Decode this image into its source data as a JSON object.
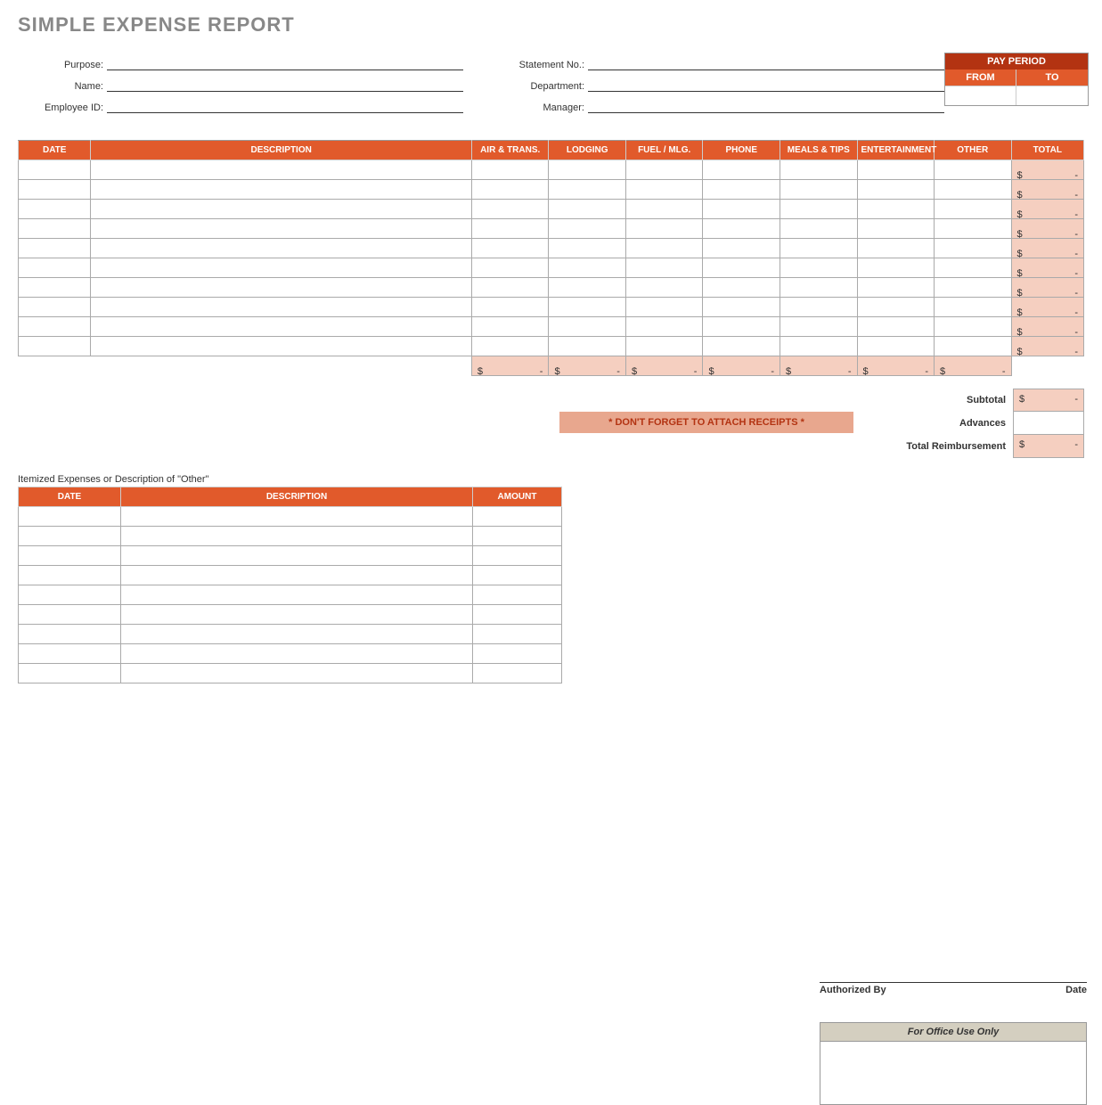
{
  "title": "SIMPLE EXPENSE REPORT",
  "header_fields_left": {
    "purpose": "Purpose:",
    "name": "Name:",
    "employee_id": "Employee ID:"
  },
  "header_fields_right": {
    "statement_no": "Statement No.:",
    "department": "Department:",
    "manager": "Manager:"
  },
  "pay_period": {
    "title": "PAY PERIOD",
    "from": "FROM",
    "to": "TO"
  },
  "main_table": {
    "headers": {
      "date": "DATE",
      "description": "DESCRIPTION",
      "air_trans": "AIR & TRANS.",
      "lodging": "LODGING",
      "fuel_mlg": "FUEL / MLG.",
      "phone": "PHONE",
      "meals_tips": "MEALS & TIPS",
      "entertainment": "ENTERTAINMENT",
      "other": "OTHER",
      "total": "TOTAL"
    },
    "row_count": 10,
    "money": {
      "currency": "$",
      "dash": "-"
    }
  },
  "receipts_banner": "* DON'T FORGET TO ATTACH RECEIPTS *",
  "summary": {
    "subtotal": "Subtotal",
    "advances": "Advances",
    "total_reimbursement": "Total Reimbursement"
  },
  "itemized": {
    "label": "Itemized Expenses or Description of \"Other\"",
    "headers": {
      "date": "DATE",
      "description": "DESCRIPTION",
      "amount": "AMOUNT"
    },
    "row_count": 9
  },
  "signature": {
    "authorized_by": "Authorized By",
    "date": "Date"
  },
  "office_box": {
    "title": "For Office Use Only"
  }
}
